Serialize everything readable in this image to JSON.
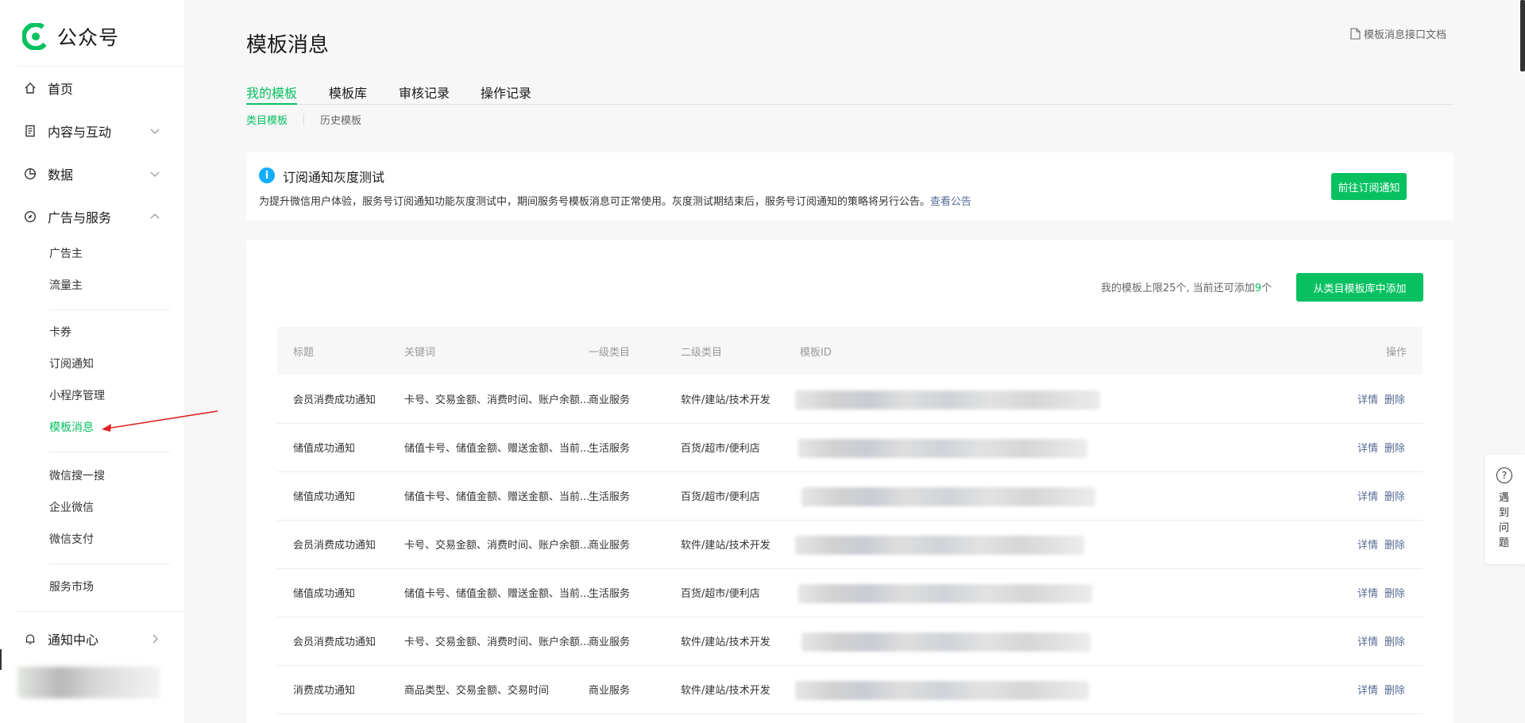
{
  "brand": {
    "name": "公众号",
    "green": "#07c160",
    "link_blue": "#576b95"
  },
  "sidebar": {
    "home": "首页",
    "content": "内容与互动",
    "data": "数据",
    "ads": "广告与服务",
    "ads_items": [
      "广告主",
      "流量主"
    ],
    "group2": [
      "卡券",
      "订阅通知",
      "小程序管理",
      "模板消息"
    ],
    "group3": [
      "微信搜一搜",
      "企业微信",
      "微信支付"
    ],
    "group4": [
      "服务市场"
    ],
    "notify": "通知中心",
    "active_item": "模板消息"
  },
  "header": {
    "title": "模板消息",
    "doc_link": "模板消息接口文档"
  },
  "tabs": [
    "我的模板",
    "模板库",
    "审核记录",
    "操作记录"
  ],
  "subtabs": [
    "类目模板",
    "历史模板"
  ],
  "notice": {
    "title": "订阅通知灰度测试",
    "text": "为提升微信用户体验，服务号订阅通知功能灰度测试中，期间服务号模板消息可正常使用。灰度测试期结束后，服务号订阅通知的策略将另行公告。",
    "link": "查看公告",
    "button": "前往订阅通知"
  },
  "quota": {
    "prefix": "我的模板上限25个, 当前还可添加",
    "count": "9",
    "suffix": "个"
  },
  "add_button": "从类目模板库中添加",
  "table": {
    "headers": [
      "标题",
      "关键词",
      "一级类目",
      "二级类目",
      "模板ID",
      "操作"
    ],
    "ops": [
      "详情",
      "删除"
    ],
    "rows": [
      {
        "title": "会员消费成功通知",
        "keywords": "卡号、交易金额、消费时间、账户余额...",
        "cat1": "商业服务",
        "cat2": "软件/建站/技术开发"
      },
      {
        "title": "储值成功通知",
        "keywords": "储值卡号、储值金额、赠送金额、当前...",
        "cat1": "生活服务",
        "cat2": "百货/超市/便利店"
      },
      {
        "title": "储值成功通知",
        "keywords": "储值卡号、储值金额、赠送金额、当前...",
        "cat1": "生活服务",
        "cat2": "百货/超市/便利店"
      },
      {
        "title": "会员消费成功通知",
        "keywords": "卡号、交易金额、消费时间、账户余额...",
        "cat1": "商业服务",
        "cat2": "软件/建站/技术开发"
      },
      {
        "title": "储值成功通知",
        "keywords": "储值卡号、储值金额、赠送金额、当前...",
        "cat1": "生活服务",
        "cat2": "百货/超市/便利店"
      },
      {
        "title": "会员消费成功通知",
        "keywords": "卡号、交易金额、消费时间、账户余额...",
        "cat1": "商业服务",
        "cat2": "软件/建站/技术开发"
      },
      {
        "title": "消费成功通知",
        "keywords": "商品类型、交易金额、交易时间",
        "cat1": "商业服务",
        "cat2": "软件/建站/技术开发"
      }
    ]
  },
  "help": "遇到问题"
}
